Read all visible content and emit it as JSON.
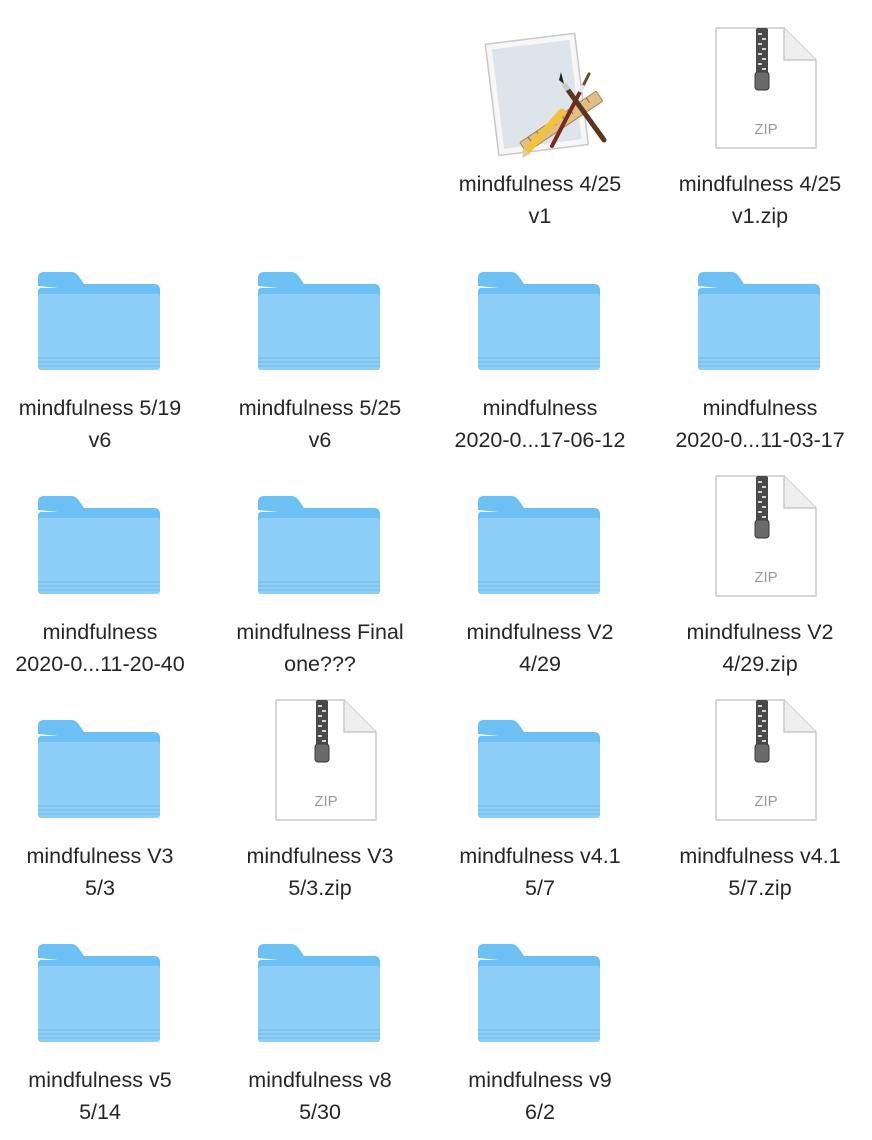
{
  "window": {
    "view": "icon-view"
  },
  "files": [
    {
      "id": "app",
      "kind": "app",
      "line1": "mindfulness 4/25",
      "line2": "v1"
    },
    {
      "id": "zip1",
      "kind": "zip",
      "line1": "mindfulness 4/25",
      "line2": "v1.zip",
      "badge": "ZIP"
    },
    {
      "id": "f519",
      "kind": "folder",
      "line1": "mindfulness 5/19",
      "line2": "v6"
    },
    {
      "id": "f525",
      "kind": "folder",
      "line1": "mindfulness 5/25",
      "line2": "v6"
    },
    {
      "id": "f17",
      "kind": "folder",
      "line1": "mindfulness",
      "line2": "2020-0...17-06-12"
    },
    {
      "id": "f11a",
      "kind": "folder",
      "line1": "mindfulness",
      "line2": "2020-0...11-03-17"
    },
    {
      "id": "f11b",
      "kind": "folder",
      "line1": "mindfulness",
      "line2": "2020-0...11-20-40"
    },
    {
      "id": "ffinal",
      "kind": "folder",
      "line1": "mindfulness Final",
      "line2": "one???"
    },
    {
      "id": "fv2",
      "kind": "folder",
      "line1": "mindfulness V2",
      "line2": "4/29"
    },
    {
      "id": "zv2",
      "kind": "zip",
      "line1": "mindfulness V2",
      "line2": "4/29.zip",
      "badge": "ZIP"
    },
    {
      "id": "fv3",
      "kind": "folder",
      "line1": "mindfulness V3",
      "line2": "5/3"
    },
    {
      "id": "zv3",
      "kind": "zip",
      "line1": "mindfulness V3",
      "line2": "5/3.zip",
      "badge": "ZIP"
    },
    {
      "id": "fv41",
      "kind": "folder",
      "line1": "mindfulness v4.1",
      "line2": "5/7"
    },
    {
      "id": "zv41",
      "kind": "zip",
      "line1": "mindfulness v4.1",
      "line2": "5/7.zip",
      "badge": "ZIP"
    },
    {
      "id": "fv5",
      "kind": "folder",
      "line1": "mindfulness v5",
      "line2": "5/14"
    },
    {
      "id": "fv8",
      "kind": "folder",
      "line1": "mindfulness v8",
      "line2": "5/30"
    },
    {
      "id": "fv9",
      "kind": "folder",
      "line1": "mindfulness v9",
      "line2": "6/2"
    }
  ],
  "colors": {
    "folder_back": "#6cc0f3",
    "folder_front": "#8dcff8",
    "label_text": "#262626",
    "zip_badge": "#9a9a9a"
  }
}
